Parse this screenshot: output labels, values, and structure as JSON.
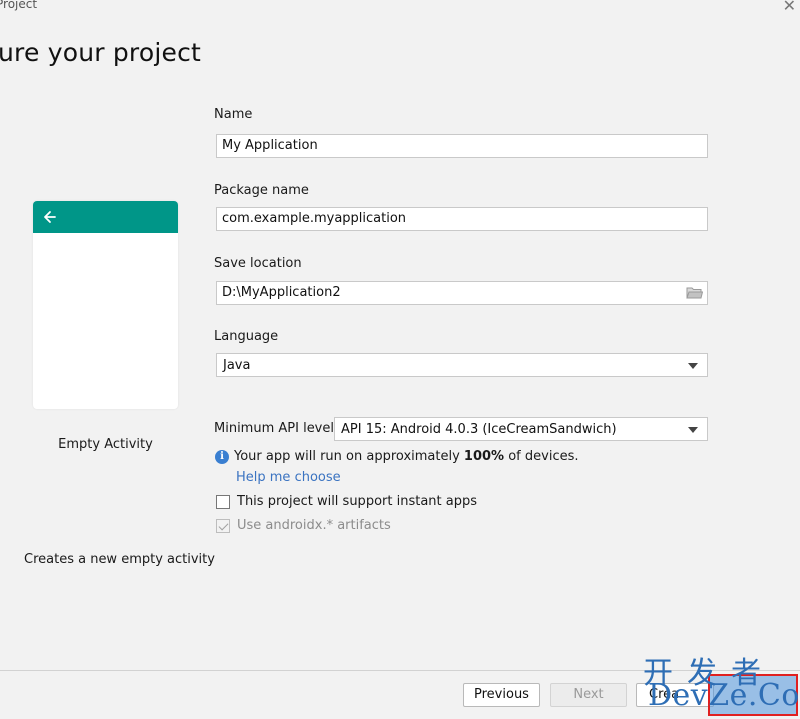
{
  "window": {
    "title": "Project",
    "close_glyph": "✕"
  },
  "page_title": "ure your project",
  "template": {
    "name": "Empty Activity",
    "description": "Creates a new empty activity",
    "preview_accent": "#009688",
    "back_icon": "arrow-left-icon"
  },
  "form": {
    "name_label": "Name",
    "name_value": "My Application",
    "package_label": "Package name",
    "package_value": "com.example.myapplication",
    "location_label": "Save location",
    "location_value": "D:\\MyApplication2",
    "location_icon": "folder-icon",
    "language_label": "Language",
    "language_value": "Java",
    "min_api_label": "Minimum API level",
    "min_api_value": "API 15: Android 4.0.3 (IceCreamSandwich)"
  },
  "info": {
    "text_before": "Your app will run on approximately ",
    "percent": "100%",
    "text_after": " of devices.",
    "help_link": "Help me choose"
  },
  "options": {
    "instant_apps_label": "This project will support instant apps",
    "instant_apps_checked": false,
    "androidx_label": "Use androidx.* artifacts",
    "androidx_checked": true
  },
  "buttons": {
    "previous": "Previous",
    "next": "Next",
    "create": "Crea"
  },
  "watermark": {
    "line1": "开发者",
    "line2": "DevZe.CoM"
  }
}
